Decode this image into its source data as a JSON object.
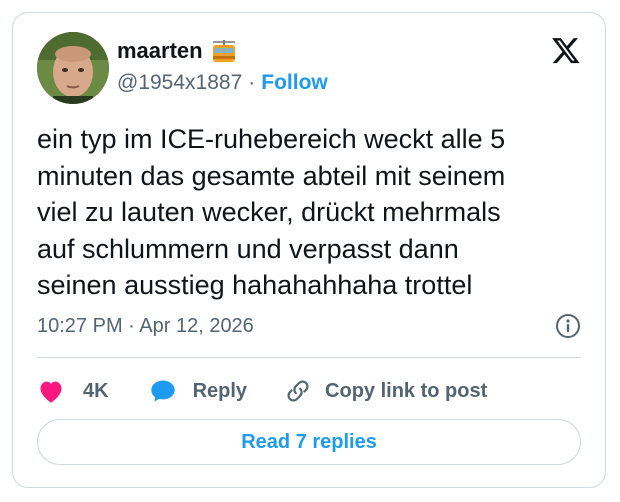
{
  "author": {
    "display_name": "maarten",
    "name_emoji": "tram-car-icon",
    "handle": "@1954x1887",
    "separator": "·",
    "follow_label": "Follow"
  },
  "tweet": {
    "text": "ein typ im ICE-ruhebereich weckt alle 5\nminuten das gesamte abteil mit seinem\nviel zu lauten wecker, drückt mehrmals\nauf schlummern und verpasst dann\nseinen ausstieg hahahahhaha trottel",
    "timestamp": "10:27 PM · Apr 12, 2026"
  },
  "actions": {
    "like_count": "4K",
    "reply_label": "Reply",
    "copy_link_label": "Copy link to post"
  },
  "footer": {
    "read_replies_label": "Read 7 replies"
  },
  "colors": {
    "accent": "#1d9bf0",
    "like": "#f91880",
    "text": "#0f1419",
    "secondary": "#536471",
    "border": "#cfd9de"
  }
}
